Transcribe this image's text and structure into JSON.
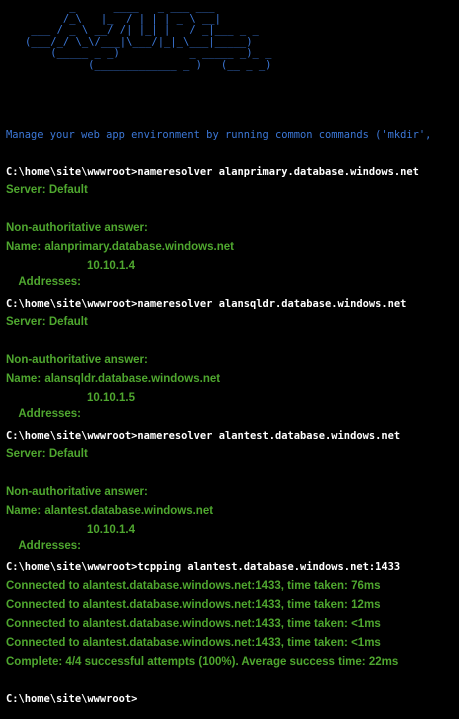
{
  "console": {
    "banner": "          _      ____   _ ___ ___\n         /_\\   |_  / | | | _ \\ __|\n    ___ / _ \\ __/ /| |_| |   / _|___ _ _\n   (___/_/ \\_\\/___|\\___/|_|_\\___|_____)\n       (_____ _ _)           _ _____ _)_ _\n             (_____________ _ )   (__ _ _)",
    "description": "Manage your web app environment by running common commands ('mkdir',",
    "lines": [
      {
        "type": "cmd",
        "text": "C:\\home\\site\\wwwroot>nameresolver alanprimary.database.windows.net"
      },
      {
        "type": "out",
        "text": "Server: Default"
      },
      {
        "type": "out",
        "text": "Non-authoritative answer:"
      },
      {
        "type": "out",
        "text": "Name: alanprimary.database.windows.net"
      },
      {
        "type": "addr",
        "label": "Addresses:",
        "value": "10.10.1.4"
      },
      {
        "type": "cmd",
        "text": "C:\\home\\site\\wwwroot>nameresolver alansqldr.database.windows.net"
      },
      {
        "type": "out",
        "text": "Server: Default"
      },
      {
        "type": "out",
        "text": "Non-authoritative answer:"
      },
      {
        "type": "out",
        "text": "Name: alansqldr.database.windows.net"
      },
      {
        "type": "addr",
        "label": "Addresses:",
        "value": "10.10.1.5"
      },
      {
        "type": "cmd",
        "text": "C:\\home\\site\\wwwroot>nameresolver alantest.database.windows.net"
      },
      {
        "type": "out",
        "text": "Server: Default"
      },
      {
        "type": "out",
        "text": "Non-authoritative answer:"
      },
      {
        "type": "out",
        "text": "Name: alantest.database.windows.net"
      },
      {
        "type": "addr",
        "label": "Addresses:",
        "value": "10.10.1.4"
      },
      {
        "type": "cmd",
        "text": "C:\\home\\site\\wwwroot>tcpping alantest.database.windows.net:1433"
      },
      {
        "type": "out",
        "text": "Connected to alantest.database.windows.net:1433, time taken: 76ms"
      },
      {
        "type": "out",
        "text": "Connected to alantest.database.windows.net:1433, time taken: 12ms"
      },
      {
        "type": "out",
        "text": "Connected to alantest.database.windows.net:1433, time taken: <1ms"
      },
      {
        "type": "out",
        "text": "Connected to alantest.database.windows.net:1433, time taken: <1ms"
      },
      {
        "type": "out",
        "text": "Complete: 4/4 successful attempts (100%). Average success time: 22ms"
      },
      {
        "type": "cmd",
        "text": "C:\\home\\site\\wwwroot>"
      }
    ]
  },
  "colors": {
    "background": "#000000",
    "banner": "#3c78d8",
    "command": "#ffffff",
    "output": "#4fa72f"
  }
}
